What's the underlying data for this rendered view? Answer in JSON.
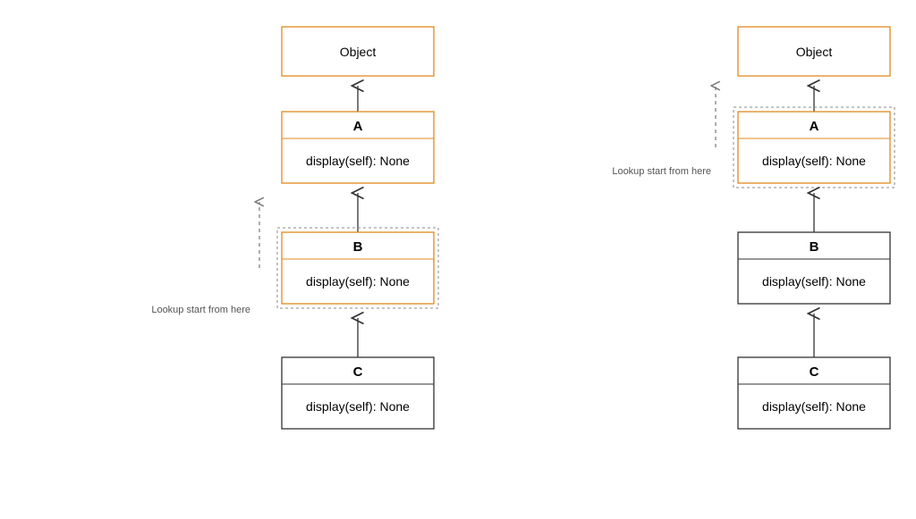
{
  "left": {
    "object_label": "Object",
    "class_a": {
      "name": "A",
      "method": "display(self): None"
    },
    "class_b": {
      "name": "B",
      "method": "display(self): None"
    },
    "class_c": {
      "name": "C",
      "method": "display(self): None"
    },
    "lookup_caption": "Lookup start from here"
  },
  "right": {
    "object_label": "Object",
    "class_a": {
      "name": "A",
      "method": "display(self): None"
    },
    "class_b": {
      "name": "B",
      "method": "display(self): None"
    },
    "class_c": {
      "name": "C",
      "method": "display(self): None"
    },
    "lookup_caption": "Lookup start from here"
  }
}
